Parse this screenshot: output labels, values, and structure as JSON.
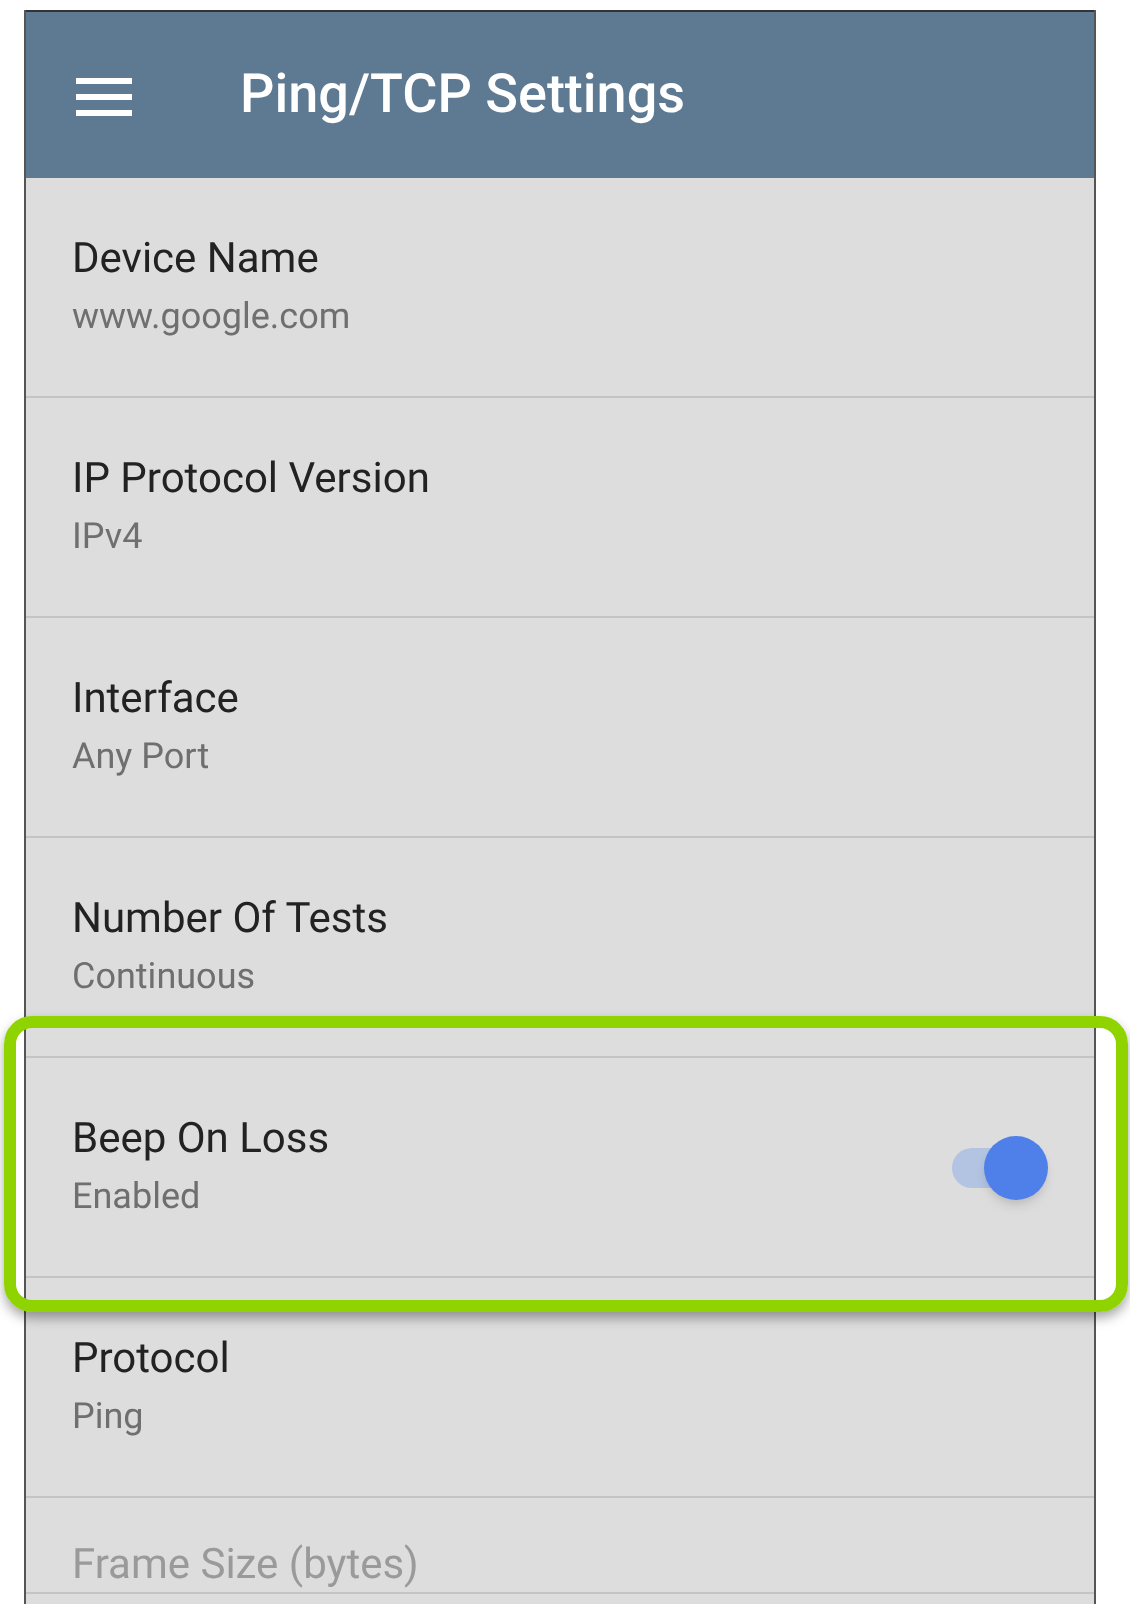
{
  "app_bar": {
    "title": "Ping/TCP Settings"
  },
  "settings": [
    {
      "kind": "text",
      "label": "Device Name",
      "value": "www.google.com",
      "highlighted": false,
      "faded": false
    },
    {
      "kind": "text",
      "label": "IP Protocol Version",
      "value": "IPv4",
      "highlighted": false,
      "faded": false
    },
    {
      "kind": "text",
      "label": "Interface",
      "value": "Any Port",
      "highlighted": false,
      "faded": false
    },
    {
      "kind": "text",
      "label": "Number Of Tests",
      "value": "Continuous",
      "highlighted": false,
      "faded": false
    },
    {
      "kind": "toggle",
      "label": "Beep On Loss",
      "value": "Enabled",
      "on": true,
      "highlighted": true,
      "faded": false
    },
    {
      "kind": "text",
      "label": "Protocol",
      "value": "Ping",
      "highlighted": false,
      "faded": false
    },
    {
      "kind": "text",
      "label": "Frame Size (bytes)",
      "highlighted": false,
      "faded": true
    }
  ]
}
